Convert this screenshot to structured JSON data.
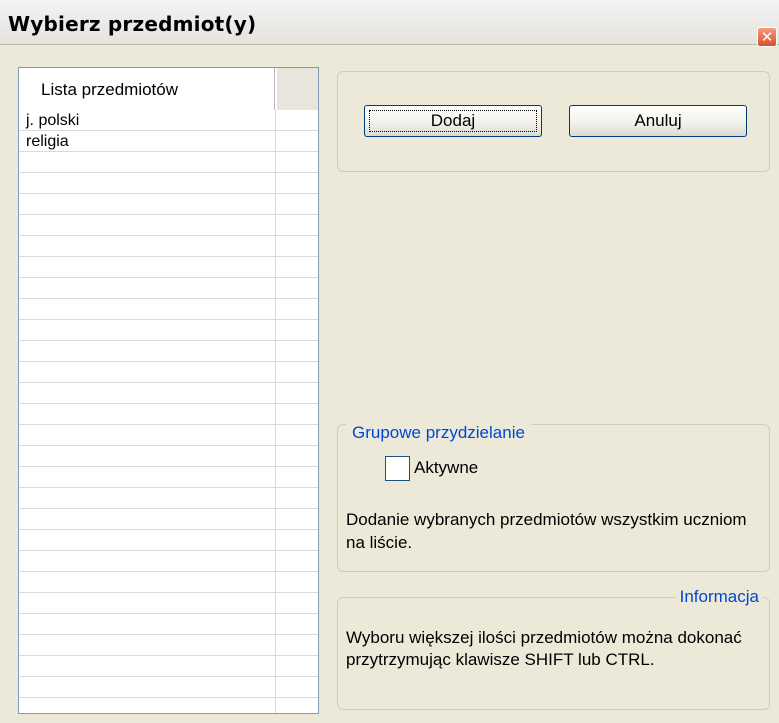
{
  "window": {
    "title": "Wybierz przedmiot(y)",
    "close_glyph": "✕"
  },
  "list": {
    "column_header": "Lista przedmiotów",
    "items": [
      "j. polski",
      "religia"
    ]
  },
  "buttons": {
    "add_label": "Dodaj",
    "cancel_label": "Anuluj"
  },
  "group_assign": {
    "legend": "Grupowe przydzielanie",
    "checkbox_label": "Aktywne",
    "checkbox_checked": false,
    "description": "Dodanie wybranych przedmiotów wszystkim uczniom na liście."
  },
  "info": {
    "legend": "Informacja",
    "text": "Wyboru większej ilości przedmiotów można dokonać przytrzymując klawisze SHIFT lub CTRL."
  },
  "colors": {
    "dialog_bg": "#ece9d8",
    "legend_text": "#0046d5",
    "close_button": "#d8502e"
  }
}
